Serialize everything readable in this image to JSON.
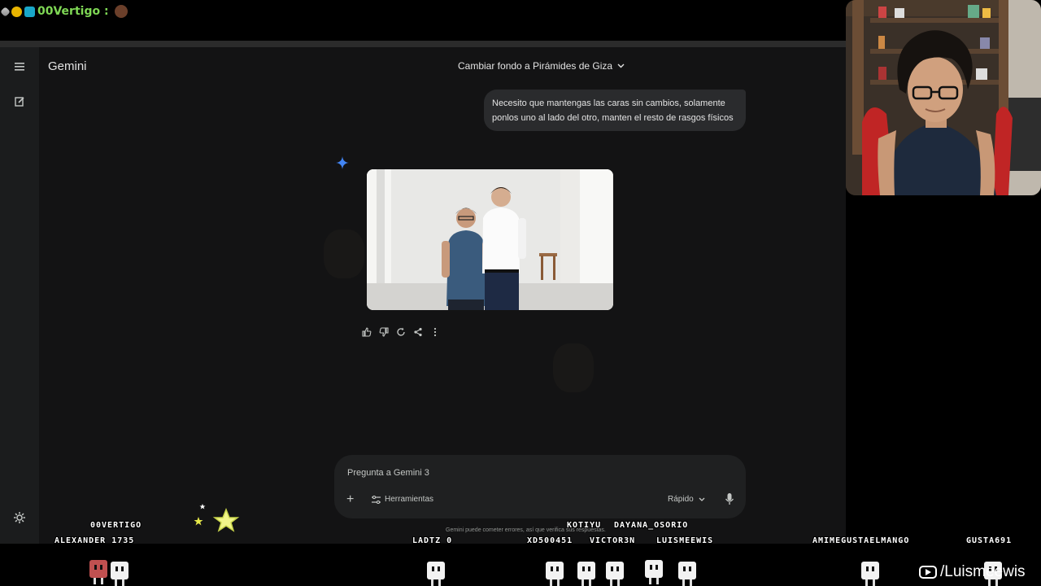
{
  "stream": {
    "top_chat_user": "00Vertigo :",
    "usernames": [
      {
        "name": "00VERTIGO"
      },
      {
        "name": "ALEXANDER_1735"
      },
      {
        "name": "LADTZ_0"
      },
      {
        "name": "KOTIYU"
      },
      {
        "name": "DAYANA_OSORIO"
      },
      {
        "name": "XD500451"
      },
      {
        "name": "VICTOR3N"
      },
      {
        "name": "LUISMEEWIS"
      },
      {
        "name": "AMIMEGUSTAELMANGO"
      },
      {
        "name": "GUSTA691"
      }
    ],
    "watermark": "/Luismeewis"
  },
  "app": {
    "brand": "Gemini",
    "conversation_title": "Cambiar fondo a Pirámides de Giza",
    "user_message": "Necesito que mantengas las caras sin cambios, solamente ponlos uno al lado del otro, manten el resto de rasgos físicos",
    "composer": {
      "placeholder": "Pregunta a Gemini 3",
      "tools_label": "Herramientas",
      "mode_label": "Rápido"
    },
    "disclaimer": "Gemini puede cometer errores, así que verifica sus respuestas."
  },
  "colors": {
    "app_bg": "#131314",
    "rail_bg": "#1b1c1d",
    "bubble_bg": "#2a2b2d",
    "accent_spark": "#4285f4",
    "username_green": "#7fd855"
  }
}
